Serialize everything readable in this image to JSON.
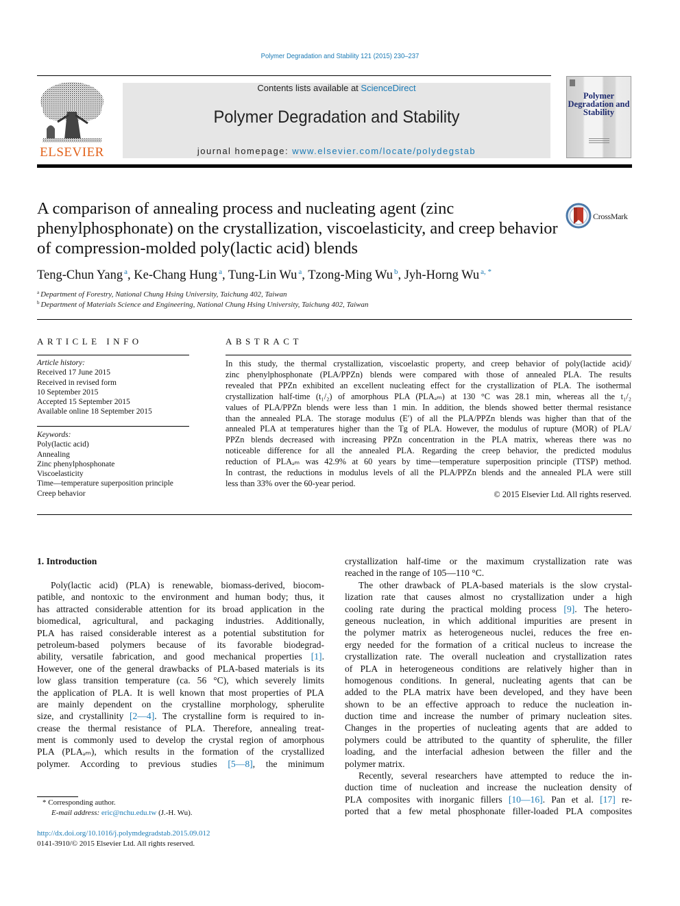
{
  "header": {
    "journal_ref": "Polymer Degradation and Stability 121 (2015) 230–237",
    "contents_prefix": "Contents lists available at ",
    "contents_link": "ScienceDirect",
    "journal_title": "Polymer Degradation and Stability",
    "homepage_prefix": "journal homepage: ",
    "homepage_link": "www.elsevier.com/locate/polydegstab",
    "publisher": "ELSEVIER",
    "cover_title": "Polymer Degradation and Stability",
    "crossmark_label": "CrossMark"
  },
  "article": {
    "title": "A comparison of annealing process and nucleating agent (zinc phenylphosphonate) on the crystallization, viscoelasticity, and creep behavior of compression-molded poly(lactic acid) blends",
    "authors": [
      {
        "name": "Teng-Chun Yang",
        "aff": "a"
      },
      {
        "name": "Ke-Chang Hung",
        "aff": "a"
      },
      {
        "name": "Tung-Lin Wu",
        "aff": "a"
      },
      {
        "name": "Tzong-Ming Wu",
        "aff": "b"
      },
      {
        "name": "Jyh-Horng Wu",
        "aff": "a, *"
      }
    ],
    "affiliations": [
      {
        "key": "a",
        "text": "Department of Forestry, National Chung Hsing University, Taichung 402, Taiwan"
      },
      {
        "key": "b",
        "text": "Department of Materials Science and Engineering, National Chung Hsing University, Taichung 402, Taiwan"
      }
    ]
  },
  "article_info": {
    "heading": "ARTICLE INFO",
    "history_label": "Article history:",
    "history": [
      "Received 17 June 2015",
      "Received in revised form",
      "10 September 2015",
      "Accepted 15 September 2015",
      "Available online 18 September 2015"
    ],
    "keywords_label": "Keywords:",
    "keywords": [
      "Poly(lactic acid)",
      "Annealing",
      "Zinc phenylphosphonate",
      "Viscoelasticity",
      "Time—temperature superposition principle",
      "Creep behavior"
    ]
  },
  "abstract": {
    "heading": "ABSTRACT",
    "lines": [
      "In this study, the thermal crystallization, viscoelastic property, and creep behavior of poly(lactide acid)/",
      "zinc phenylphosphonate (PLA/PPZn) blends were compared with those of annealed PLA. The results",
      "revealed that PPZn exhibited an excellent nucleating effect for the crystallization of PLA. The isothermal",
      "crystallization half-time (t₁/₂) of amorphous PLA (PLAₐₘ) at 130 °C was 28.1 min, whereas all the t₁/₂",
      "values of PLA/PPZn blends were less than 1 min. In addition, the blends showed better thermal resistance",
      "than the annealed PLA. The storage modulus (E′) of all the PLA/PPZn blends was higher than that of the",
      "annealed PLA at temperatures higher than the Tg of PLA. However, the modulus of rupture (MOR) of PLA/",
      "PPZn blends decreased with increasing PPZn concentration in the PLA matrix, whereas there was no",
      "noticeable difference for all the annealed PLA. Regarding the creep behavior, the predicted modulus",
      "reduction of PLAₐₘ was 42.9% at 60 years by time—temperature superposition principle (TTSP) method.",
      "In contrast, the reductions in modulus levels of all the PLA/PPZn blends and the annealed PLA were still",
      "less than 33% over the 60-year period."
    ],
    "copyright": "© 2015 Elsevier Ltd. All rights reserved."
  },
  "body": {
    "section_heading": "1.  Introduction",
    "left_lines": [
      "Poly(lactic acid) (PLA) is renewable, biomass-derived, biocom-",
      "patible, and nontoxic to the environment and human body; thus, it",
      "has attracted considerable attention for its broad application in the",
      "biomedical, agricultural, and packaging industries. Additionally,",
      "PLA has raised considerable interest as a potential substitution for",
      "petroleum-based polymers because of its favorable biodegrad-",
      "ability, versatile fabrication, and good mechanical properties [1].",
      "However, one of the general drawbacks of PLA-based materials is its",
      "low glass transition temperature (ca. 56 °C), which severely limits",
      "the application of PLA. It is well known that most properties of PLA",
      "are mainly dependent on the crystalline morphology, spherulite",
      "size, and crystallinity [2—4]. The crystalline form is required to in-",
      "crease the thermal resistance of PLA. Therefore, annealing treat-",
      "ment is commonly used to develop the crystal region of amorphous",
      "PLA (PLAₐₘ), which results in the formation of the crystallized",
      "polymer. According to previous studies [5—8], the minimum"
    ],
    "right_lines": [
      "crystallization half-time or the maximum crystallization rate was",
      "reached in the range of 105—110 °C.",
      "The other drawback of PLA-based materials is the slow crystal-",
      "lization rate that causes almost no crystallization under a high",
      "cooling rate during the practical molding process [9]. The hetero-",
      "geneous nucleation, in which additional impurities are present in",
      "the polymer matrix as heterogeneous nuclei, reduces the free en-",
      "ergy needed for the formation of a critical nucleus to increase the",
      "crystallization rate. The overall nucleation and crystallization rates",
      "of PLA in heterogeneous conditions are relatively higher than in",
      "homogenous conditions. In general, nucleating agents that can be",
      "added to the PLA matrix have been developed, and they have been",
      "shown to be an effective approach to reduce the nucleation in-",
      "duction time and increase the number of primary nucleation sites.",
      "Changes in the properties of nucleating agents that are added to",
      "polymers could be attributed to the quantity of spherulite, the filler",
      "loading, and the interfacial adhesion between the filler and the",
      "polymer matrix.",
      "Recently, several researchers have attempted to reduce the in-",
      "duction time of nucleation and increase the nucleation density of",
      "PLA composites with inorganic fillers [10—16]. Pan et al. [17] re-",
      "ported that a few metal phosphonate filler-loaded PLA composites"
    ]
  },
  "footnotes": {
    "corresponding": "*  Corresponding author.",
    "email_label": "E-mail address: ",
    "email": "eric@nchu.edu.tw",
    "email_suffix": " (J.-H. Wu).",
    "doi": "http://dx.doi.org/10.1016/j.polymdegradstab.2015.09.012",
    "issn": "0141-3910/© 2015 Elsevier Ltd. All rights reserved."
  },
  "colors": {
    "link": "#1a7ab5",
    "publisher_orange": "#e2621b",
    "banner_bg": "#e6e6e6",
    "cover_title": "#1d2a6f",
    "crossmark_red": "#c0392b"
  }
}
